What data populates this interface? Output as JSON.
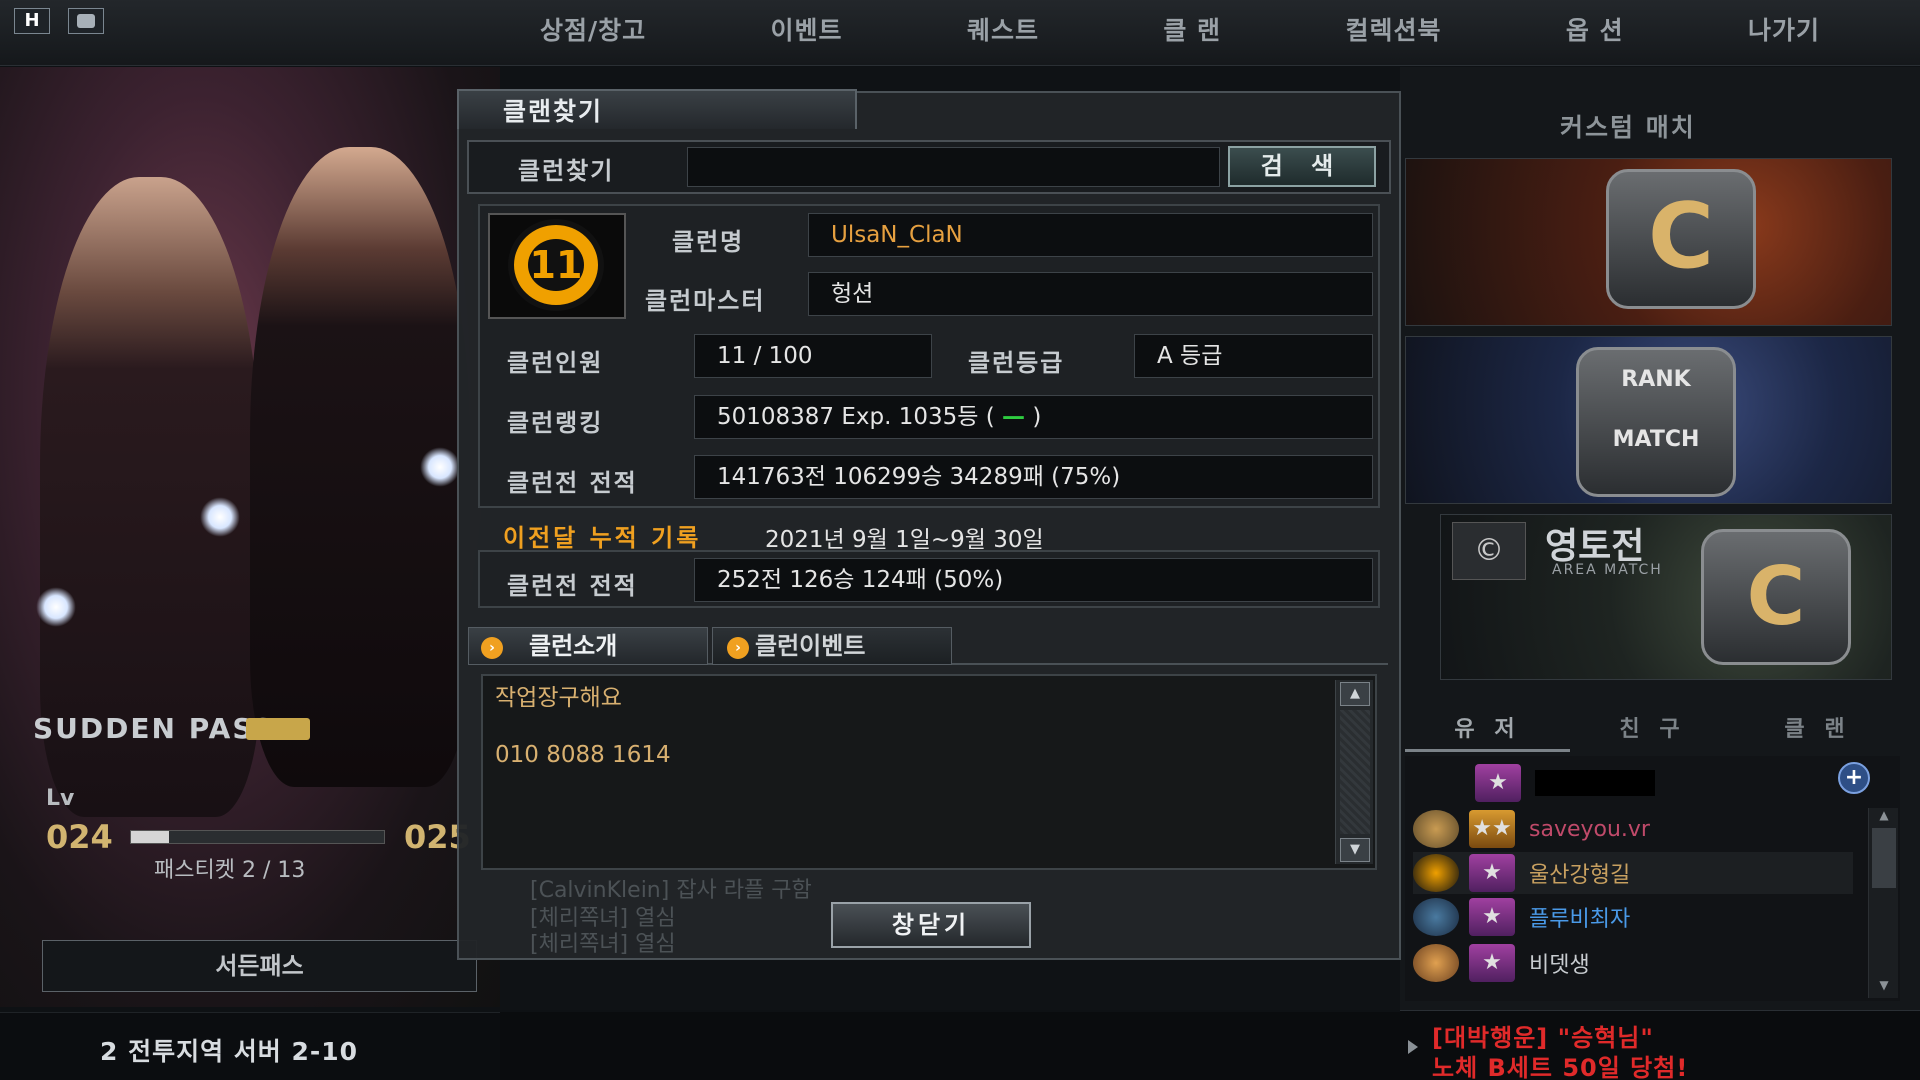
{
  "topbar": {
    "icons": [
      "H",
      ""
    ],
    "nav": [
      "상점/창고",
      "이벤트",
      "퀘스트",
      "클 랜",
      "컬렉션북",
      "옵 션",
      "나가기"
    ]
  },
  "left": {
    "pass_title": "SUDDEN PASS",
    "lv_label": "Lv",
    "lv_current": "024",
    "lv_next": "025",
    "lv_progress": 0.15,
    "ticket": "패스티켓 2 / 13",
    "pass_button": "서든패스"
  },
  "bottom": {
    "server": "2 전투지역 서버 2-10",
    "ticker_line1": "[대박행운] \"승혁님\"",
    "ticker_line2": "노체 B세트 50일  당첨!"
  },
  "right": {
    "custom_match": "커스텀 매치",
    "rank_match": "RANK MATCH",
    "area_title": "영토전",
    "area_sub": "AREA MATCH",
    "tabs": [
      "유 저",
      "친 구",
      "클 랜"
    ],
    "users": [
      {
        "name": ""
      },
      {
        "name": "saveyou.vr"
      },
      {
        "name": "울산강형길"
      },
      {
        "name": "플루비최자"
      },
      {
        "name": "비뎃생"
      }
    ]
  },
  "dialog": {
    "title": "클랜찾기",
    "search_label": "클런찾기",
    "search_value": "",
    "search_button": "검 색",
    "clan_name_label": "클런명",
    "clan_name": "UlsaN_ClaN",
    "master_label": "클런마스터",
    "master": "헝션",
    "members_label": "클런인원",
    "members": "11 / 100",
    "grade_label": "클런등급",
    "grade": "A 등급",
    "ranking_label": "클런랭킹",
    "ranking": "50108387 Exp.  1035등 (",
    "ranking_change": "—",
    "ranking_close": " )",
    "record_label": "클런전 전적",
    "record": "141763전 106299승 34289패 (75%)",
    "history_label": "이전달 누적 기록",
    "history_date": "2021년 9월 1일~9월 30일",
    "history_record_label": "클런전 전적",
    "history_record": "252전 126승 124패 (50%)",
    "tab_intro": "클런소개",
    "tab_event": "클런이벤트",
    "intro_lines": [
      "작업장구해요",
      "",
      "010 8088 1614"
    ],
    "chat_ghost": [
      "[CalvinKlein] 잡사 라플 구함",
      "[체리쪽녀]         열심",
      "[체리쪽녀]         열심"
    ],
    "close_button": "창닫기"
  }
}
